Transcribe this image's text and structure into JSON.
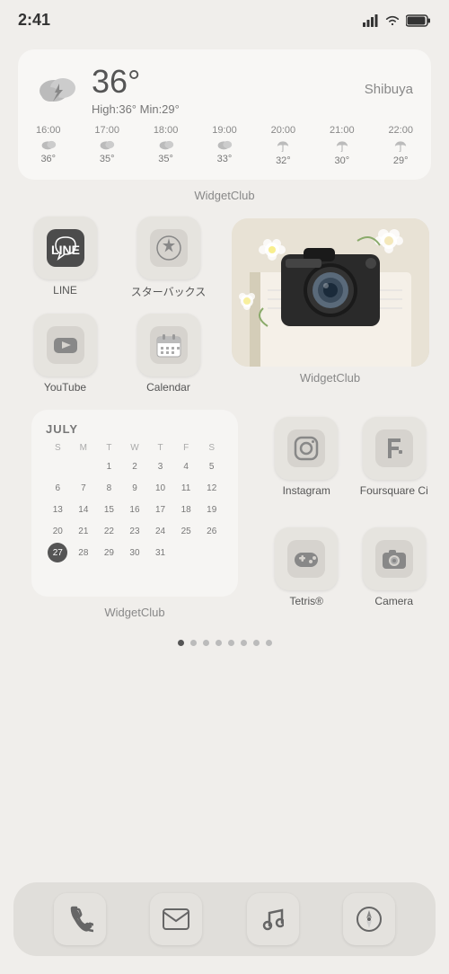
{
  "statusBar": {
    "time": "2:41",
    "signal": "●●●●",
    "wifi": "wifi",
    "battery": "battery"
  },
  "weather": {
    "location": "Shibuya",
    "temp": "36°",
    "highLow": "High:36°  Min:29°",
    "hours": [
      {
        "time": "16:00",
        "icon": "cloud",
        "temp": "36°"
      },
      {
        "time": "17:00",
        "icon": "cloud",
        "temp": "35°"
      },
      {
        "time": "18:00",
        "icon": "cloud",
        "temp": "35°"
      },
      {
        "time": "19:00",
        "icon": "cloud",
        "temp": "33°"
      },
      {
        "time": "20:00",
        "icon": "umbrella",
        "temp": "32°"
      },
      {
        "time": "21:00",
        "icon": "umbrella",
        "temp": "30°"
      },
      {
        "time": "22:00",
        "icon": "umbrella",
        "temp": "29°"
      }
    ]
  },
  "widgetClubLabel1": "WidgetClub",
  "widgetClubLabel2": "WidgetClub",
  "widgetClubLabel3": "WidgetClub",
  "apps": {
    "row1": [
      {
        "name": "LINE",
        "label": "LINE",
        "icon": "line"
      },
      {
        "name": "Starbucks",
        "label": "スターバックス",
        "icon": "starbucks"
      }
    ],
    "row2": [
      {
        "name": "YouTube",
        "label": "YouTube",
        "icon": "youtube"
      },
      {
        "name": "Calendar",
        "label": "Calendar",
        "icon": "calendar"
      }
    ],
    "right": [
      {
        "name": "Instagram",
        "label": "Instagram",
        "icon": "instagram"
      },
      {
        "name": "Foursquare",
        "label": "Foursquare Ci",
        "icon": "foursquare"
      },
      {
        "name": "Tetris",
        "label": "Tetris®",
        "icon": "tetris"
      },
      {
        "name": "Camera",
        "label": "Camera",
        "icon": "camera"
      }
    ]
  },
  "calendar": {
    "month": "JULY",
    "dayHeaders": [
      "S",
      "M",
      "T",
      "W",
      "T",
      "F",
      "S"
    ],
    "days": [
      "",
      "",
      "1",
      "2",
      "3",
      "4",
      "5",
      "6",
      "7",
      "8",
      "9",
      "10",
      "11",
      "12",
      "13",
      "14",
      "15",
      "16",
      "17",
      "18",
      "19",
      "20",
      "21",
      "22",
      "23",
      "24",
      "25",
      "26",
      "27",
      "28",
      "29",
      "30",
      "31",
      "",
      "",
      ""
    ],
    "today": "27"
  },
  "pageDots": {
    "total": 8,
    "active": 0
  },
  "dock": {
    "items": [
      {
        "name": "Phone",
        "icon": "phone"
      },
      {
        "name": "Mail",
        "icon": "mail"
      },
      {
        "name": "Music",
        "icon": "music"
      },
      {
        "name": "Safari",
        "icon": "compass"
      }
    ]
  }
}
